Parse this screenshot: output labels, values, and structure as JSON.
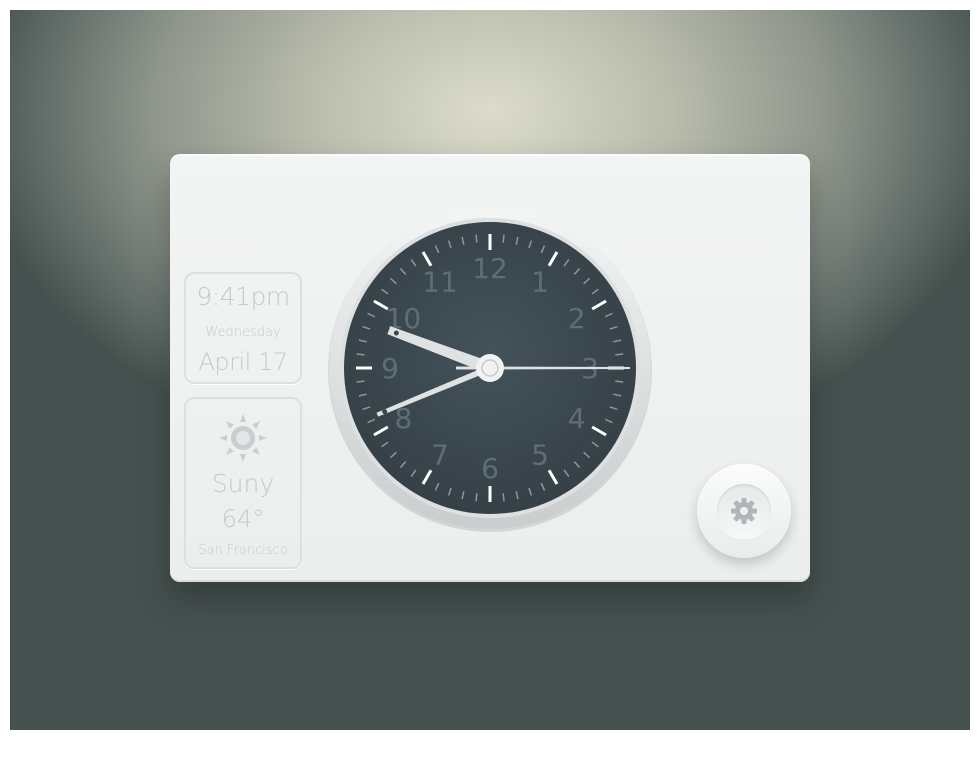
{
  "time_card": {
    "time": "9:41pm",
    "weekday": "Wednesday",
    "date": "April 17"
  },
  "weather_card": {
    "icon": "sun-icon",
    "condition": "Suny",
    "temperature": "64°",
    "city": "San Francisco"
  },
  "clock": {
    "numerals": [
      "12",
      "1",
      "2",
      "3",
      "4",
      "5",
      "6",
      "7",
      "8",
      "9",
      "10",
      "11"
    ],
    "hour": 9,
    "minute": 41,
    "second": 15,
    "face_color": "#3a474d",
    "hand_color": "#dfe2e3",
    "numeral_color": "#5f6e74"
  },
  "settings": {
    "icon": "gear-icon"
  }
}
